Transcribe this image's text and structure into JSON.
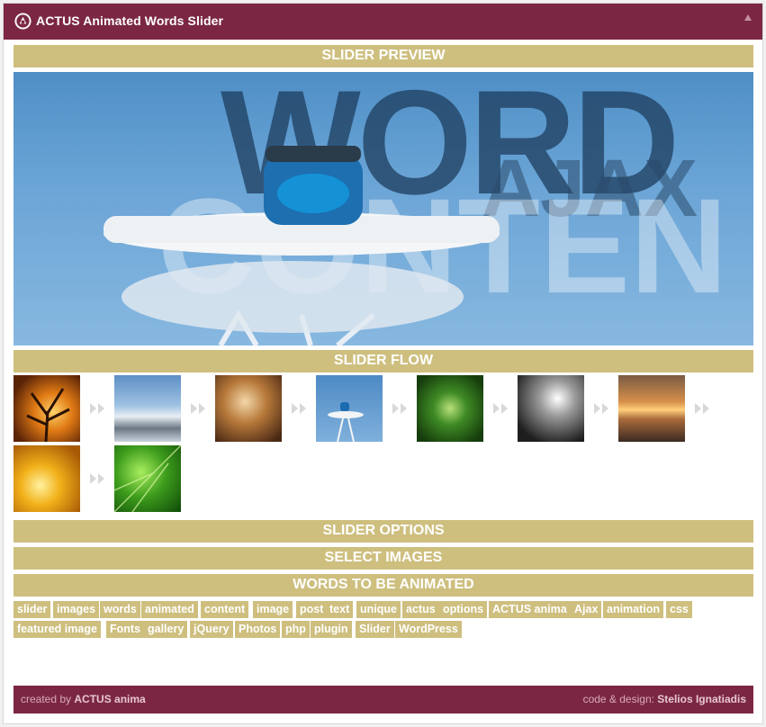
{
  "header": {
    "title": "ACTUS Animated Words Slider",
    "logo_icon": "actus-logo-icon",
    "collapse_icon": "collapse-arrow-icon"
  },
  "sections": {
    "preview": "SLIDER PREVIEW",
    "flow": "SLIDER FLOW",
    "options": "SLIDER OPTIONS",
    "select_images": "SELECT IMAGES",
    "words": "WORDS TO BE ANIMATED"
  },
  "preview_words": [
    "WORD",
    "AJAX",
    "CONTEN"
  ],
  "flow_images": [
    "tree-sunset-thumbnail",
    "snowy-mountains-thumbnail",
    "woman-violin-thumbnail",
    "jar-on-stand-thumbnail",
    "green-succulent-thumbnail",
    "light-bulb-thumbnail",
    "orange-sky-clouds-thumbnail",
    "yellow-leaf-droplets-thumbnail",
    "green-leaf-thumbnail"
  ],
  "tags": [
    "slider",
    "images",
    "words",
    "animated",
    "content",
    "image",
    "post",
    "text",
    "unique",
    "actus",
    "options",
    "ACTUS anima",
    "Ajax",
    "animation",
    "css",
    "featured image",
    "Fonts",
    "gallery",
    "jQuery",
    "Photos",
    "php",
    "plugin",
    "Slider",
    "WordPress"
  ],
  "footer": {
    "created_prefix": "created by ",
    "created_name": "ACTUS anima",
    "design_prefix": "code & design: ",
    "design_name": "Stelios Ignatiadis"
  },
  "colors": {
    "header": "#7b2743",
    "band": "#cebf7f",
    "footer": "#7b2743"
  }
}
